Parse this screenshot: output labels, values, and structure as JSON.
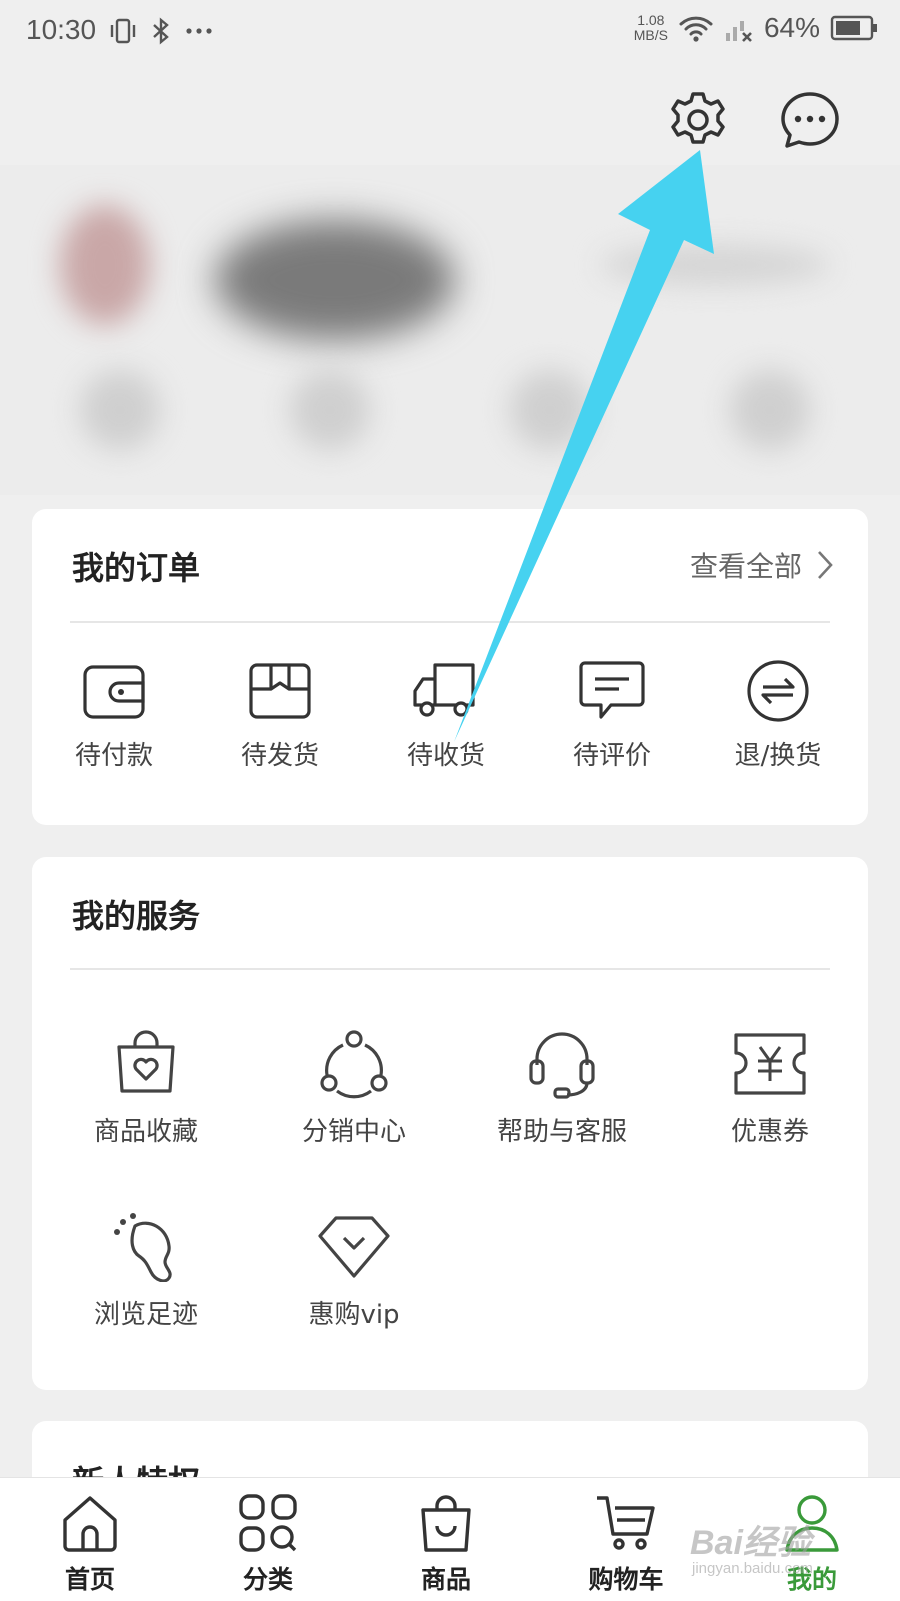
{
  "status_bar": {
    "time": "10:30",
    "speed_value": "1.08",
    "speed_unit": "MB/S",
    "battery": "64%",
    "icons": [
      "vibrate-icon",
      "bluetooth-icon",
      "more-dots-icon",
      "wifi-icon",
      "signal-icon",
      "battery-icon"
    ]
  },
  "header": {
    "icons": [
      "settings-icon",
      "message-icon"
    ]
  },
  "orders": {
    "title": "我的订单",
    "view_all": "查看全部",
    "items": [
      {
        "label": "待付款",
        "icon": "wallet-icon"
      },
      {
        "label": "待发货",
        "icon": "package-icon"
      },
      {
        "label": "待收货",
        "icon": "truck-icon"
      },
      {
        "label": "待评价",
        "icon": "comment-icon"
      },
      {
        "label": "退/换货",
        "icon": "exchange-icon"
      }
    ]
  },
  "services": {
    "title": "我的服务",
    "items": [
      {
        "label": "商品收藏",
        "icon": "favorite-bag-icon"
      },
      {
        "label": "分销中心",
        "icon": "share-network-icon"
      },
      {
        "label": "帮助与客服",
        "icon": "headset-icon"
      },
      {
        "label": "优惠券",
        "icon": "coupon-icon"
      },
      {
        "label": "浏览足迹",
        "icon": "footprint-icon"
      },
      {
        "label": "惠购vip",
        "icon": "diamond-icon"
      }
    ]
  },
  "next_card": {
    "title": "新人特权"
  },
  "tabbar": {
    "items": [
      {
        "label": "首页",
        "icon": "home-icon"
      },
      {
        "label": "分类",
        "icon": "category-icon"
      },
      {
        "label": "商品",
        "icon": "shopping-bag-icon"
      },
      {
        "label": "购物车",
        "icon": "cart-icon"
      },
      {
        "label": "我的",
        "icon": "user-icon"
      }
    ],
    "active_index": 4
  },
  "watermark": {
    "text": "Bai经验",
    "sub": "jingyan.baidu.com"
  },
  "colors": {
    "accent_green": "#3a9a3a",
    "arrow": "#46d2f0"
  }
}
